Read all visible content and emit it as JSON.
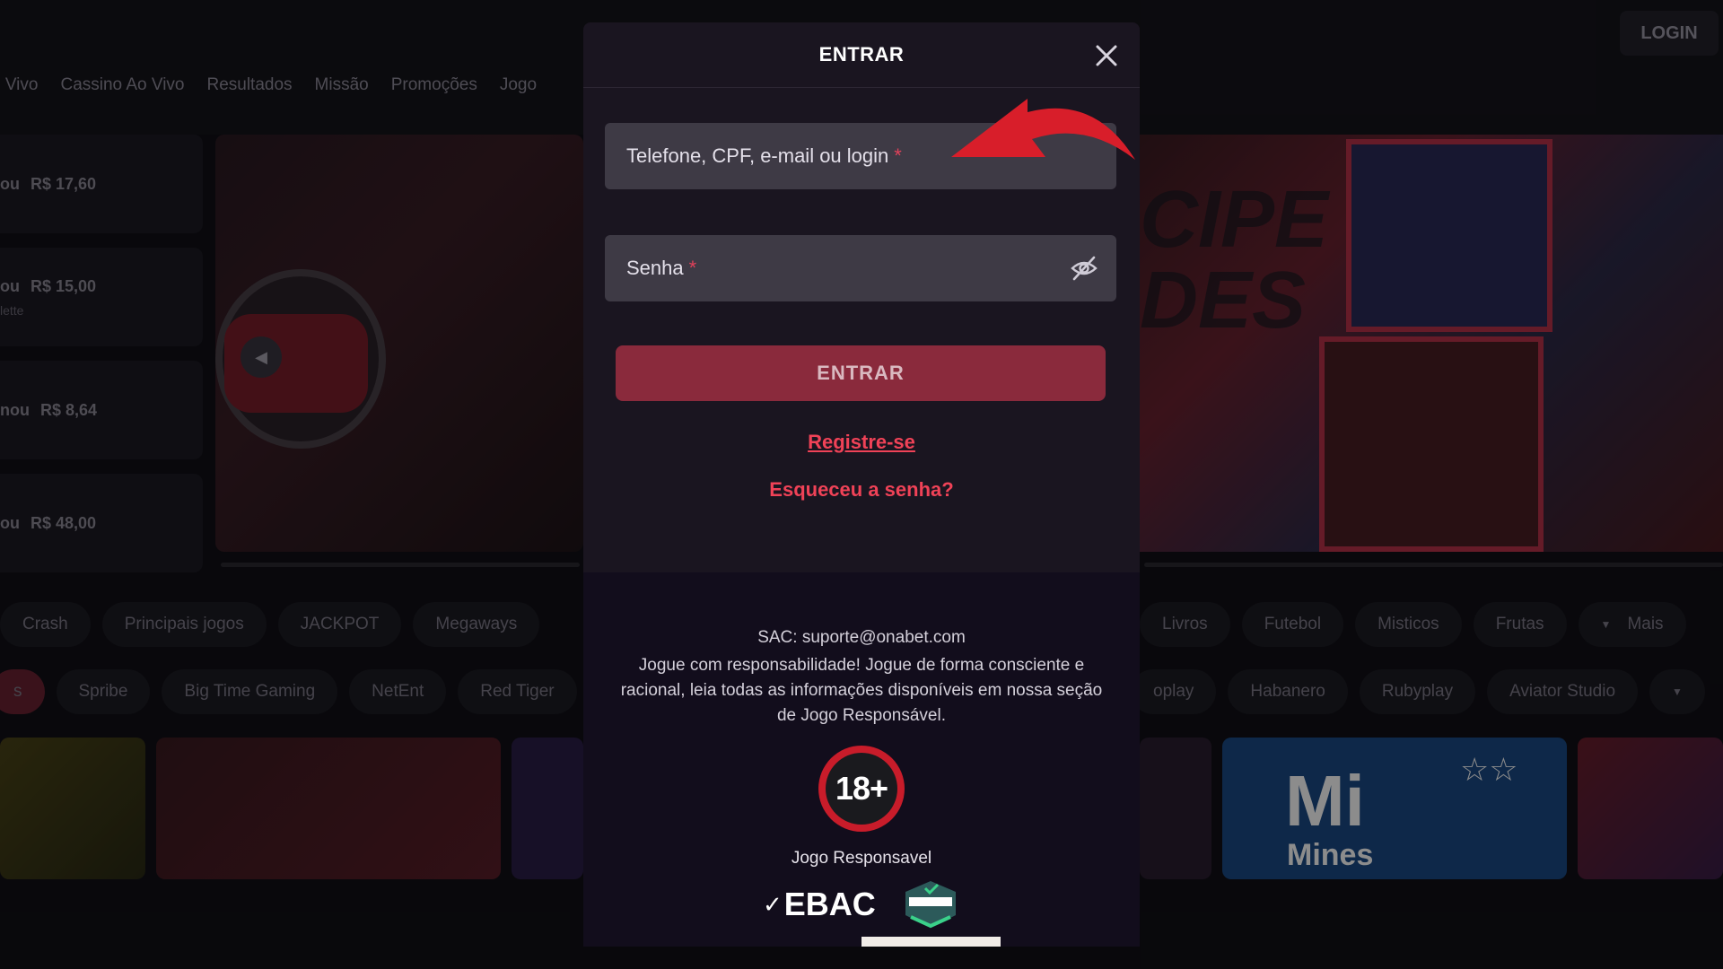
{
  "header": {
    "login_label": "LOGIN",
    "nav": [
      "o Vivo",
      "Cassino Ao Vivo",
      "Resultados",
      "Missão",
      "Promoções",
      "Jogo"
    ]
  },
  "winners": [
    {
      "prefix": "ou",
      "amount": "R$ 17,60",
      "sub": ""
    },
    {
      "prefix": "ou",
      "amount": "R$ 15,00",
      "sub": "lette"
    },
    {
      "prefix": "nou",
      "amount": "R$ 8,64",
      "sub": ""
    },
    {
      "prefix": "ou",
      "amount": "R$ 48,00",
      "sub": ""
    }
  ],
  "category_chips_left": [
    "Crash",
    "Principais jogos",
    "JACKPOT",
    "Megaways"
  ],
  "category_chips_right": [
    "Livros",
    "Futebol",
    "Misticos",
    "Frutas",
    "Mais"
  ],
  "provider_chips_left": [
    "s",
    "Spribe",
    "Big Time Gaming",
    "NetEnt",
    "Red Tiger"
  ],
  "provider_chips_right": [
    "oplay",
    "Habanero",
    "Rubyplay",
    "Aviator Studio"
  ],
  "game_tiles": {
    "mines_title": "Mi",
    "mines_sub": "Mines"
  },
  "modal": {
    "title": "ENTRAR",
    "username_placeholder": "Telefone, CPF, e-mail ou login",
    "password_placeholder": "Senha",
    "required_mark": "*",
    "submit_label": "ENTRAR",
    "register_link": "Registre-se",
    "forgot_link": "Esqueceu a senha?",
    "footer": {
      "sac": "SAC: suporte@onabet.com",
      "responsibility_text": "Jogue com responsabilidade! Jogue de forma consciente e racional, leia todas as informações disponíveis em nossa seção de Jogo Responsável.",
      "age_badge": "18+",
      "responsible_label": "Jogo Responsavel",
      "ebac_logo": "EBAC"
    }
  },
  "colors": {
    "accent_red": "#f04257",
    "button_red": "#8a2a3c",
    "modal_bg": "#1a1520",
    "field_bg": "#3e3a45"
  }
}
